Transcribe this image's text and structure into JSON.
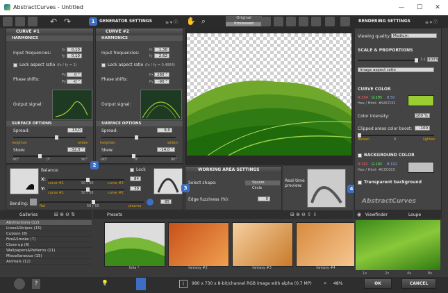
{
  "window": {
    "title": "AbstractCurves - Untitled",
    "minimize": "—",
    "maximize": "☐",
    "close": "✕"
  },
  "generator": {
    "title": "GENERATOR SETTINGS",
    "badge": "1"
  },
  "view_tabs": {
    "original": "Original",
    "processed": "Processed"
  },
  "curve1": {
    "title": "CURVE #1",
    "harmonics": "HARMONICS",
    "input_freq_label": "Input frequencies:",
    "fx_label": "fx",
    "fy_label": "fy",
    "fx": "0,10",
    "fy": "0,10",
    "lock_label": "Lock aspect ratio",
    "lock_note": "(fx / fy = 1)",
    "phase_label": "Phase shifts:",
    "px_label": "Px",
    "py_label": "Py",
    "px": "0 °",
    "py": "-0 °",
    "output_label": "Output signal:",
    "surface": "SURFACE OPTIONS",
    "spread_label": "Spread:",
    "spread": "13,0",
    "heighten": "heighten",
    "widen": "widen",
    "skew_label": "Skew:",
    "skew": "-32,0 °",
    "tick_neg": "-90°",
    "tick_zero": "0°",
    "tick_pos": "90°"
  },
  "curve2": {
    "title": "CURVE #2",
    "harmonics": "HARMONICS",
    "input_freq_label": "Input frequencies:",
    "fx_label": "fx",
    "fy_label": "fy",
    "fx": "1,38",
    "fy": "2,62",
    "lock_label": "Lock aspect ratio",
    "lock_note": "(fx / fy = 0,4884)",
    "phase_label": "Phase shifts:",
    "px_label": "Px",
    "py_label": "Py",
    "px": "280 °",
    "py": "-90 °",
    "output_label": "Output signal:",
    "surface": "SURFACE OPTIONS",
    "spread_label": "Spread:",
    "spread": "9,0",
    "heighten": "heighten",
    "widen": "widen",
    "skew_label": "Skew:",
    "skew": "-14,0 °",
    "tick_neg": "-90°",
    "tick_zero": "0°",
    "tick_pos": "90°"
  },
  "balance": {
    "badge": "2",
    "label": "Balance:",
    "lock_label": "Lock",
    "x_label": "X:",
    "y_label": "Y:",
    "curve1": "curve #1",
    "curve2": "curve #2",
    "x_ratio": "50 / 50",
    "y_ratio": "50 / 50",
    "x_value": "84",
    "y_value": "38",
    "bending_label": "Bending:",
    "flat": "flat",
    "plasma": "plasma",
    "bending_ratio": "50 / 50",
    "bending_value": "85"
  },
  "working_area": {
    "title": "WORKING AREA SETTINGS",
    "badge": "3",
    "select_shape": "Select shape:",
    "square": "Square",
    "circle": "Circle",
    "realtime": "Real-time preview:",
    "edge_label": "Edge fuzziness (%):",
    "edge_value": "0"
  },
  "rendering": {
    "title": "RENDERING SETTINGS",
    "viewing_quality_label": "Viewing quality:",
    "viewing_quality": "Medium",
    "scale_title": "SCALE & PROPORTIONS",
    "scale_ratio": "1:1",
    "scale_percent": "300%",
    "aspect": "Image aspect ratio",
    "curve_color_title": "CURVE COLOR",
    "r_label": "R:",
    "g_label": "G:",
    "b_label": "B:",
    "r": "154",
    "g": "205",
    "b": "50",
    "hex_label": "Hex / Html:",
    "hex": "#9ACD32",
    "curve_color_hex": "#9ACD32",
    "intensity_label": "Color intensity:",
    "intensity": "100 %",
    "clipped_label": "Clipped areas color boost:",
    "clipped": "-100",
    "darken": "darken",
    "zero": "0",
    "lighten": "lighten",
    "bg_title": "BACKGROUND COLOR",
    "bg_r": "192",
    "bg_g": "192",
    "bg_b": "192",
    "bg_hex": "#C0C0C0",
    "bg_color_hex": "#C0C0C0",
    "transparent_label": "Transparent background",
    "badge": "4",
    "logo": "AbstractCurves"
  },
  "galleries": {
    "title": "Galleries",
    "presets": "Presets",
    "items": [
      "Abstractions (12)",
      "Lines&Stripes (15)",
      "Cubism (8)",
      "Fire&Smoke (7)",
      "Close-up (6)",
      "Wallpapers&Patterns (11)",
      "Miscellaneous (15)",
      "Animals (12)"
    ]
  },
  "presets": {
    "items": [
      "folia *",
      "fantasy #2",
      "fantasy #3",
      "fantasy #4"
    ]
  },
  "viewfinder": {
    "viewfinder": "Viewfinder",
    "loupe": "Loupe",
    "zoom_levels": [
      "1x",
      "2x",
      "4x",
      "8x"
    ]
  },
  "status": {
    "image_info": "980 x 730 x 8-bit/channel RGB image with alpha  (0.7 MP)",
    "zoom": "48%",
    "ok": "OK",
    "cancel": "CANCEL"
  }
}
